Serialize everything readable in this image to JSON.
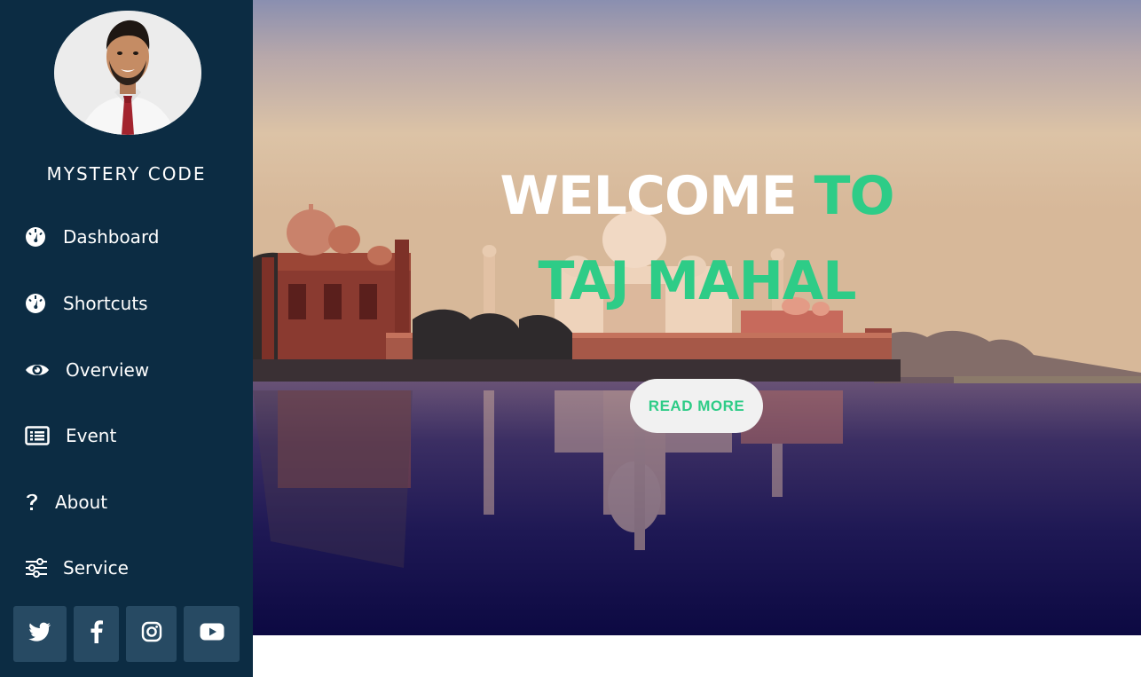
{
  "profile": {
    "name": "MYSTERY CODE"
  },
  "nav": {
    "items": [
      {
        "label": "Dashboard",
        "icon": "dashboard-icon"
      },
      {
        "label": "Shortcuts",
        "icon": "tachometer-icon"
      },
      {
        "label": "Overview",
        "icon": "eye-icon"
      },
      {
        "label": "Event",
        "icon": "list-icon"
      },
      {
        "label": "About",
        "icon": "question-icon"
      },
      {
        "label": "Service",
        "icon": "sliders-icon"
      }
    ]
  },
  "social": [
    {
      "icon": "twitter-icon"
    },
    {
      "icon": "facebook-icon"
    },
    {
      "icon": "instagram-icon"
    },
    {
      "icon": "youtube-icon"
    }
  ],
  "hero": {
    "line1_white": "WELCOME",
    "line1_green": "TO",
    "line2_green": "TAJ MAHAL",
    "button": "READ MORE"
  },
  "colors": {
    "sidebar": "#0c2c43",
    "accent": "#2ecc87",
    "social_bg": "#274a63"
  }
}
